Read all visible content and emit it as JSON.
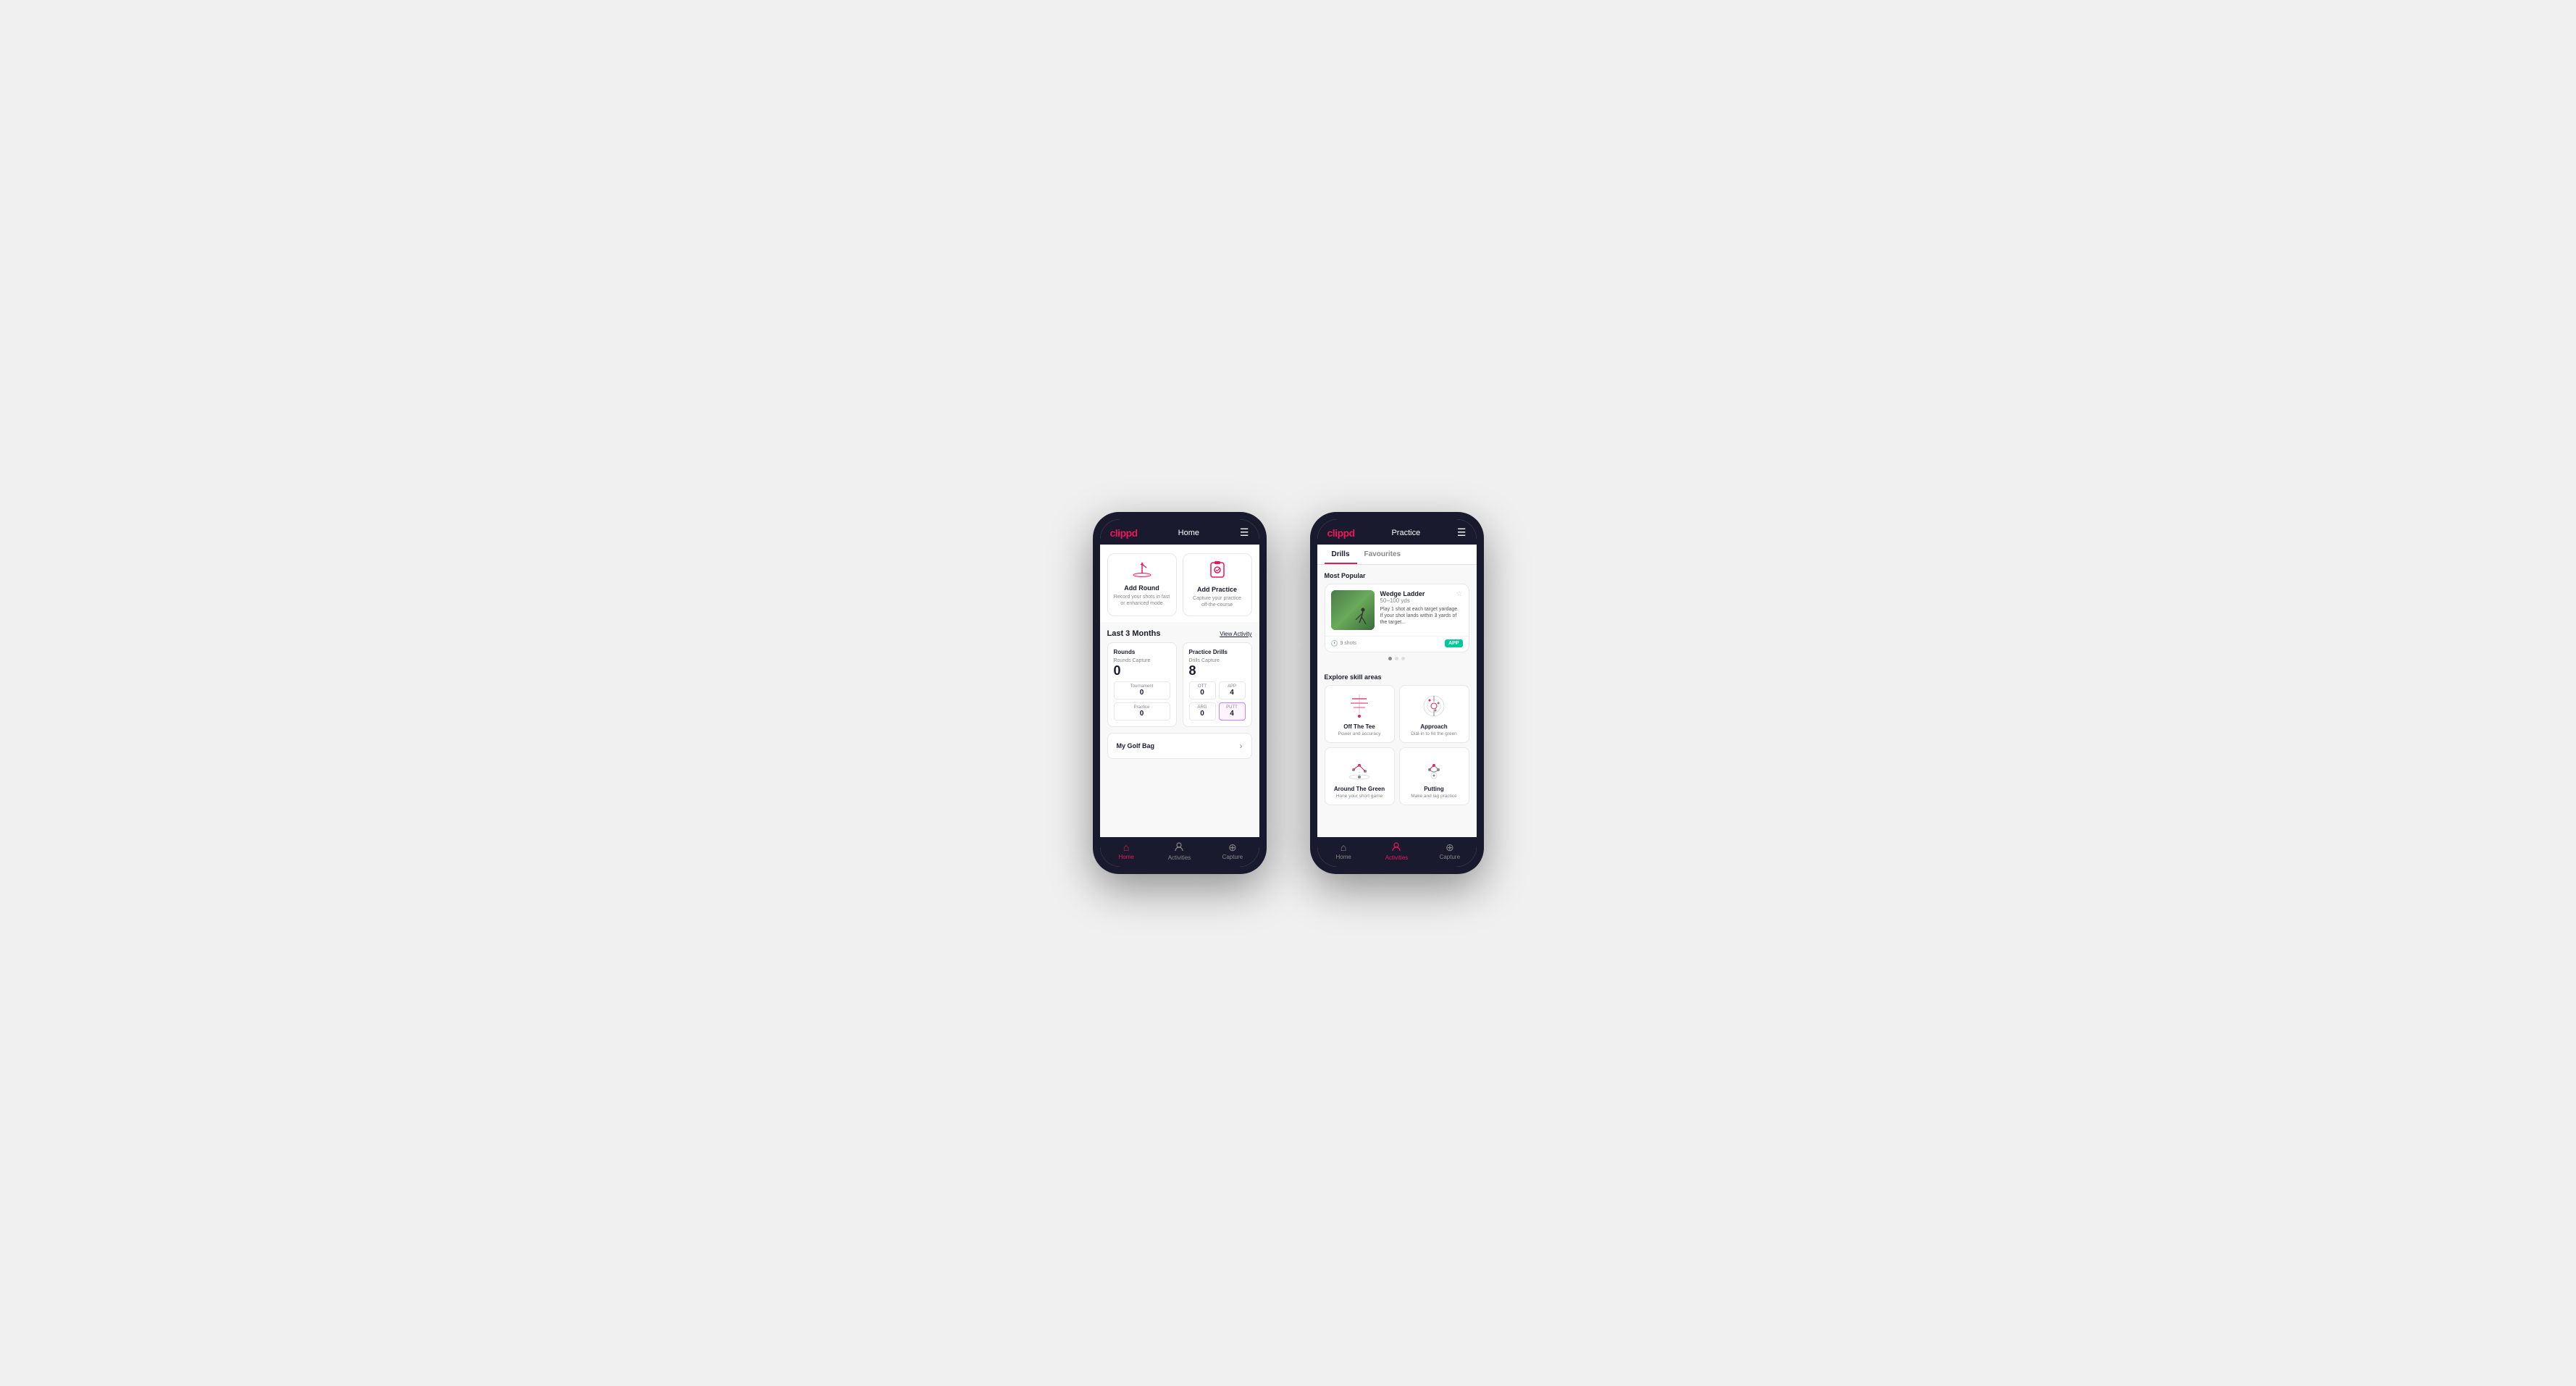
{
  "phone1": {
    "header": {
      "logo": "clippd",
      "title": "Home",
      "menu_icon": "☰"
    },
    "action_cards": [
      {
        "id": "add-round",
        "icon": "⛳",
        "title": "Add Round",
        "desc": "Record your shots in fast or enhanced mode"
      },
      {
        "id": "add-practice",
        "icon": "📋",
        "title": "Add Practice",
        "desc": "Capture your practice off-the-course"
      }
    ],
    "last3months": {
      "label": "Last 3 Months",
      "view_activity": "View Activity"
    },
    "rounds": {
      "title": "Rounds",
      "capture_label": "Rounds Capture",
      "total": "0",
      "tournament_label": "Tournament",
      "tournament_val": "0",
      "practice_label": "Practice",
      "practice_val": "0"
    },
    "practice_drills": {
      "title": "Practice Drills",
      "capture_label": "Drills Capture",
      "total": "8",
      "ott_label": "OTT",
      "ott_val": "0",
      "app_label": "APP",
      "app_val": "4",
      "arg_label": "ARG",
      "arg_val": "0",
      "putt_label": "PUTT",
      "putt_val": "4"
    },
    "golf_bag": {
      "label": "My Golf Bag"
    },
    "nav": {
      "home": "Home",
      "activities": "Activities",
      "capture": "Capture"
    }
  },
  "phone2": {
    "header": {
      "logo": "clippd",
      "title": "Practice",
      "menu_icon": "☰"
    },
    "tabs": [
      {
        "id": "drills",
        "label": "Drills",
        "active": true
      },
      {
        "id": "favourites",
        "label": "Favourites",
        "active": false
      }
    ],
    "most_popular": {
      "title": "Most Popular",
      "drill": {
        "title": "Wedge Ladder",
        "distance": "50–100 yds",
        "desc": "Play 1 shot at each target yardage. If your shot lands within 3 yards of the target...",
        "shots": "9 shots",
        "badge": "APP"
      }
    },
    "skill_areas": {
      "title": "Explore skill areas",
      "items": [
        {
          "id": "off-the-tee",
          "name": "Off The Tee",
          "desc": "Power and accuracy"
        },
        {
          "id": "approach",
          "name": "Approach",
          "desc": "Dial-in to hit the green"
        },
        {
          "id": "around-the-green",
          "name": "Around The Green",
          "desc": "Hone your short game"
        },
        {
          "id": "putting",
          "name": "Putting",
          "desc": "Make and lag practice"
        }
      ]
    },
    "nav": {
      "home": "Home",
      "activities": "Activities",
      "capture": "Capture"
    },
    "colors": {
      "accent": "#e8195a",
      "dark": "#1a1a2e",
      "green": "#00c896"
    }
  }
}
